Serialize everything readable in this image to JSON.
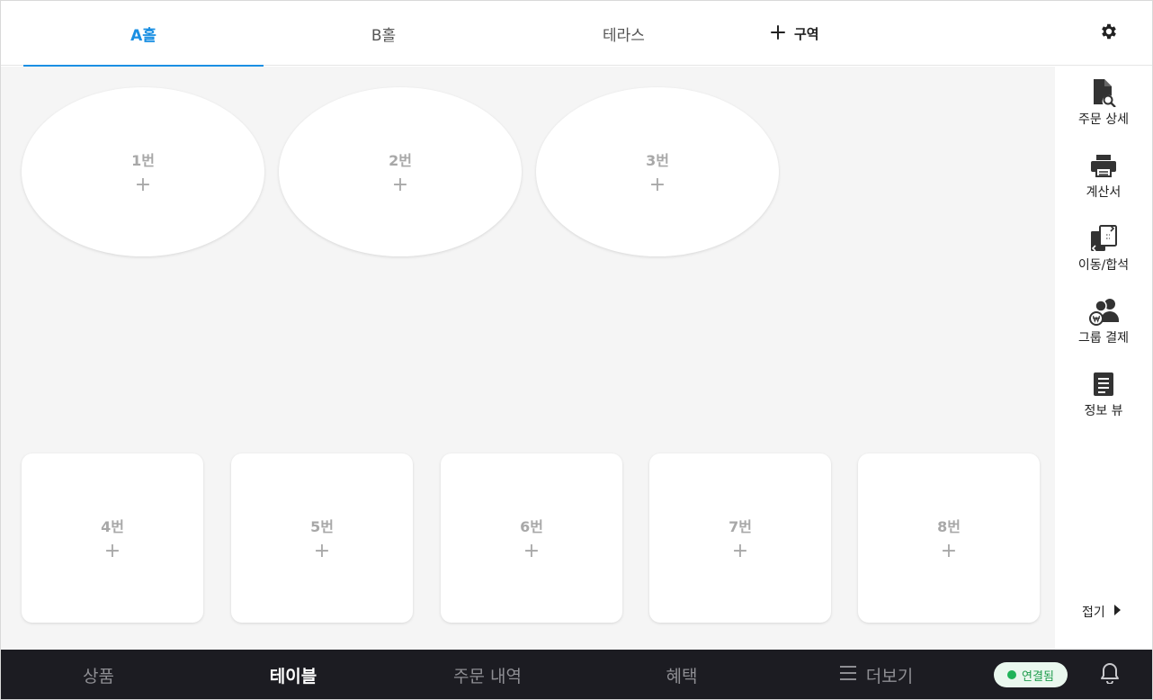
{
  "tabs": [
    {
      "label": "A홀",
      "active": true
    },
    {
      "label": "B홀",
      "active": false
    },
    {
      "label": "테라스",
      "active": false
    }
  ],
  "add_zone": {
    "icon": "plus-icon",
    "label": "구역"
  },
  "settings_icon": "gear-icon",
  "tables_top": [
    {
      "name": "1번",
      "plus": "+"
    },
    {
      "name": "2번",
      "plus": "+"
    },
    {
      "name": "3번",
      "plus": "+"
    }
  ],
  "tables_bottom": [
    {
      "name": "4번",
      "plus": "+"
    },
    {
      "name": "5번",
      "plus": "+"
    },
    {
      "name": "6번",
      "plus": "+"
    },
    {
      "name": "7번",
      "plus": "+"
    },
    {
      "name": "8번",
      "plus": "+"
    }
  ],
  "sidebar": {
    "items": [
      {
        "icon": "document-search-icon",
        "label": "주문 상세"
      },
      {
        "icon": "printer-icon",
        "label": "계산서"
      },
      {
        "icon": "move-merge-icon",
        "label": "이동/합석"
      },
      {
        "icon": "group-payment-icon",
        "label": "그룹 결제"
      },
      {
        "icon": "document-list-icon",
        "label": "정보 뷰"
      }
    ],
    "collapse_label": "접기"
  },
  "bottom_nav": {
    "items": [
      {
        "label": "상품",
        "active": false
      },
      {
        "label": "테이블",
        "active": true
      },
      {
        "label": "주문 내역",
        "active": false
      },
      {
        "label": "혜택",
        "active": false
      },
      {
        "label": "더보기",
        "active": false,
        "icon": "menu-icon"
      }
    ],
    "status_label": "연결됨",
    "bell_icon": "bell-icon"
  },
  "colors": {
    "accent": "#1a8fe3",
    "canvas": "#f5f5f5",
    "bottom_bar": "#1c1c22",
    "connected": "#1fb358"
  }
}
